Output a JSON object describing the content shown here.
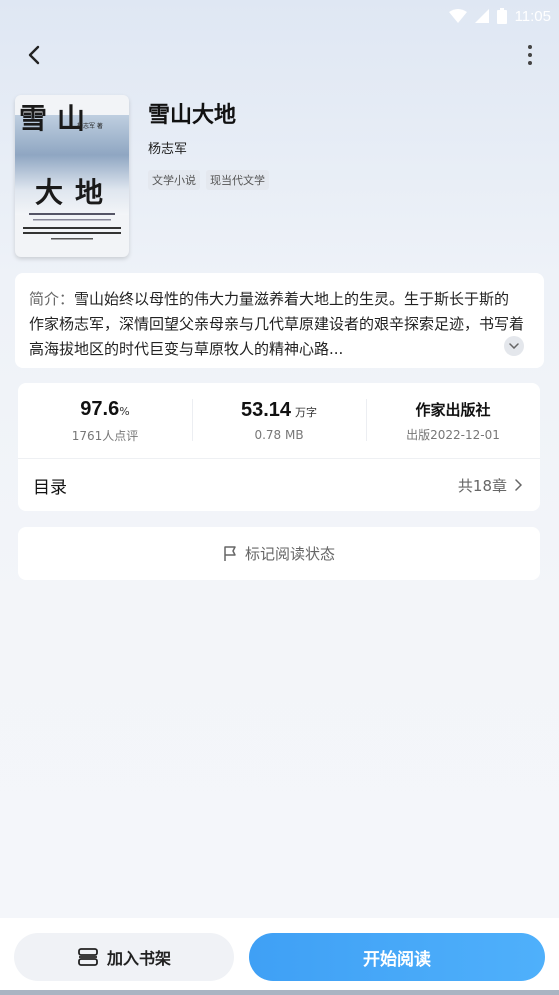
{
  "status_bar": {
    "time": "11:05"
  },
  "book": {
    "title": "雪山大地",
    "author": "杨志军",
    "tags": [
      "文学小说",
      "现当代文学"
    ],
    "cover": {
      "title_top": "雪山",
      "title_bottom": "大地",
      "author": "杨志军 著"
    }
  },
  "description": {
    "prefix": "简介：",
    "text": "雪山始终以母性的伟大力量滋养着大地上的生灵。生于斯长于斯的作家杨志军，深情回望父亲母亲与几代草原建设者的艰辛探索足迹，书写着高海拔地区的时代巨变与草原牧人的精神心路..."
  },
  "stats": {
    "rating": {
      "value": "97.6",
      "unit": "%",
      "sub": "1761人点评"
    },
    "words": {
      "value": "53.14",
      "unit": "万字",
      "sub": "0.78 MB"
    },
    "publisher": {
      "value": "作家出版社",
      "sub": "出版2022-12-01"
    }
  },
  "toc": {
    "label": "目录",
    "count": "共18章"
  },
  "mark": {
    "label": "标记阅读状态"
  },
  "actions": {
    "shelf_label": "加入书架",
    "read_label": "开始阅读"
  },
  "colors": {
    "accent": "#3fa0f5",
    "background": "#eef2f8"
  }
}
